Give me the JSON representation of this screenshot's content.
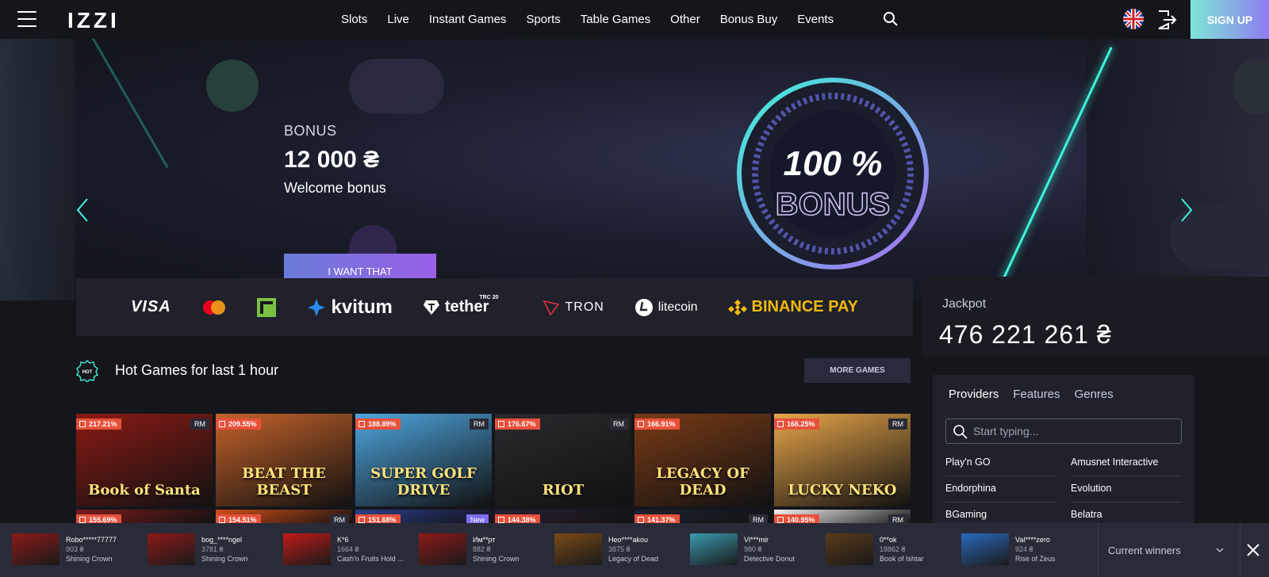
{
  "header": {
    "logo": "IZZI",
    "nav": [
      "Slots",
      "Live",
      "Instant Games",
      "Sports",
      "Table Games",
      "Other",
      "Bonus Buy",
      "Events"
    ],
    "signup_label": "SIGN UP",
    "accent_gradient": [
      "#7ee6d6",
      "#8e7cf0"
    ]
  },
  "banner": {
    "label": "BONUS",
    "amount": "12 000 ₴",
    "subtitle": "Welcome bonus",
    "cta": "I WANT THAT",
    "art_text_main": "100 %",
    "art_text_sub": "BONUS"
  },
  "payments": {
    "visa": "VISA",
    "kvitum": "kvitum",
    "tether": "tether",
    "tether_tag": "TRC 20",
    "tron": "TRON",
    "litecoin": "litecoin",
    "binance": "BINANCE PAY"
  },
  "jackpot": {
    "title": "Jackpot",
    "value": "476 221 261 ₴"
  },
  "hot_games": {
    "icon_text": "HOT",
    "title": "Hot Games for last 1 hour",
    "more_label": "MORE GAMES",
    "rows": [
      [
        {
          "title": "Book of Santa",
          "pct": "217.21%",
          "badge": "RM",
          "bg": "#8a1a14"
        },
        {
          "title": "BEAT THE BEAST",
          "pct": "209.55%",
          "badge": "",
          "bg": "#c4622a"
        },
        {
          "title": "SUPER GOLF DRIVE",
          "pct": "188.89%",
          "badge": "RM",
          "bg": "#4ea6e0"
        },
        {
          "title": "RIOT",
          "pct": "176.67%",
          "badge": "RM",
          "bg": "#2a2a2e"
        },
        {
          "title": "LEGACY OF DEAD",
          "pct": "166.91%",
          "badge": "",
          "bg": "#7a3b16"
        },
        {
          "title": "LUCKY NEKO",
          "pct": "166.25%",
          "badge": "RM",
          "bg": "#e8a54a"
        }
      ],
      [
        {
          "title": "",
          "pct": "155.69%",
          "badge": "",
          "bg": "#7a1c1c"
        },
        {
          "title": "",
          "pct": "154.51%",
          "badge": "RM",
          "bg": "#d04e18"
        },
        {
          "title": "",
          "pct": "151.68%",
          "badge": "New",
          "bg": "#2c3f8c"
        },
        {
          "title": "",
          "pct": "144.38%",
          "badge": "",
          "bg": "#2a2034"
        },
        {
          "title": "",
          "pct": "141.37%",
          "badge": "RM",
          "bg": "#1c2230"
        },
        {
          "title": "",
          "pct": "140.95%",
          "badge": "RM",
          "bg": "#f2f2f4"
        }
      ]
    ]
  },
  "providers": {
    "tabs": [
      "Providers",
      "Features",
      "Genres"
    ],
    "search_placeholder": "Start typing...",
    "items": [
      "Play'n GO",
      "Amusnet Interactive",
      "Endorphina",
      "Evolution",
      "BGaming",
      "Belatra"
    ]
  },
  "winners": {
    "items": [
      {
        "name": "Robo*****77777",
        "amount": "903 ₴",
        "game": "Shining Crown",
        "bg": "#8c1a18"
      },
      {
        "name": "bog_****ngel",
        "amount": "3781 ₴",
        "game": "Shining Crown",
        "bg": "#8c1a18"
      },
      {
        "name": "K*6",
        "amount": "1664 ₴",
        "game": "Cash'n Fruits Hold ...",
        "bg": "#c21a1a"
      },
      {
        "name": "Им**рт",
        "amount": "882 ₴",
        "game": "Shining Crown",
        "bg": "#8c1a18"
      },
      {
        "name": "Heo****akou",
        "amount": "3875 ₴",
        "game": "Legacy of Dead",
        "bg": "#7a4a16"
      },
      {
        "name": "Vl***mir",
        "amount": "980 ₴",
        "game": "Detective Donut",
        "bg": "#3a9ab0"
      },
      {
        "name": "0**ok",
        "amount": "18862 ₴",
        "game": "Book of Ishtar",
        "bg": "#5a3a1a"
      },
      {
        "name": "Val****zero",
        "amount": "924 ₴",
        "game": "Rise of Zeus",
        "bg": "#2a6ac0"
      }
    ],
    "select_label": "Current winners"
  }
}
